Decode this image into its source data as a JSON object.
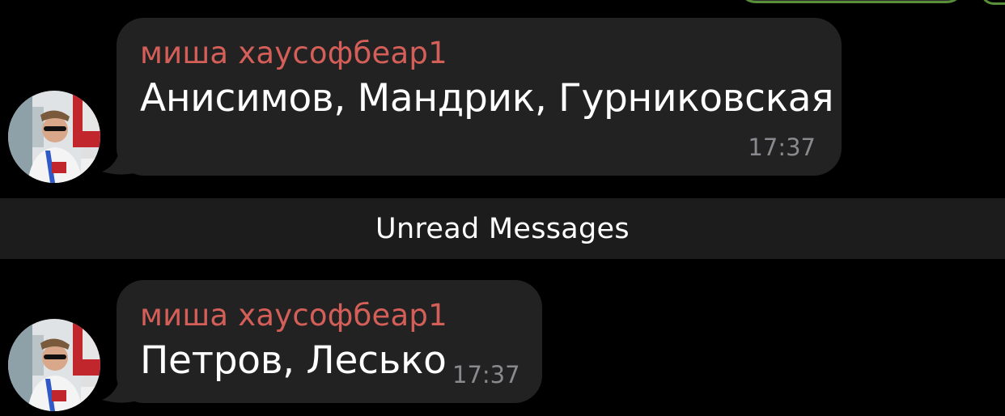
{
  "messages": [
    {
      "sender": "миша хаусофбеар1",
      "text": "Анисимов, Мандрик, Гурниковская",
      "time": "17:37"
    },
    {
      "sender": "миша хаусофбеар1",
      "text": "Петров, Лесько",
      "time": "17:37"
    }
  ],
  "divider": {
    "label": "Unread Messages"
  },
  "colors": {
    "background": "#000000",
    "bubble": "#222223",
    "sender_name": "#d45e58",
    "time": "#8a8a8e",
    "divider_bg": "#1c1c1d",
    "outgoing_border": "#5a8f3a"
  },
  "icons": {
    "avatar": "user-photo-avatar"
  }
}
